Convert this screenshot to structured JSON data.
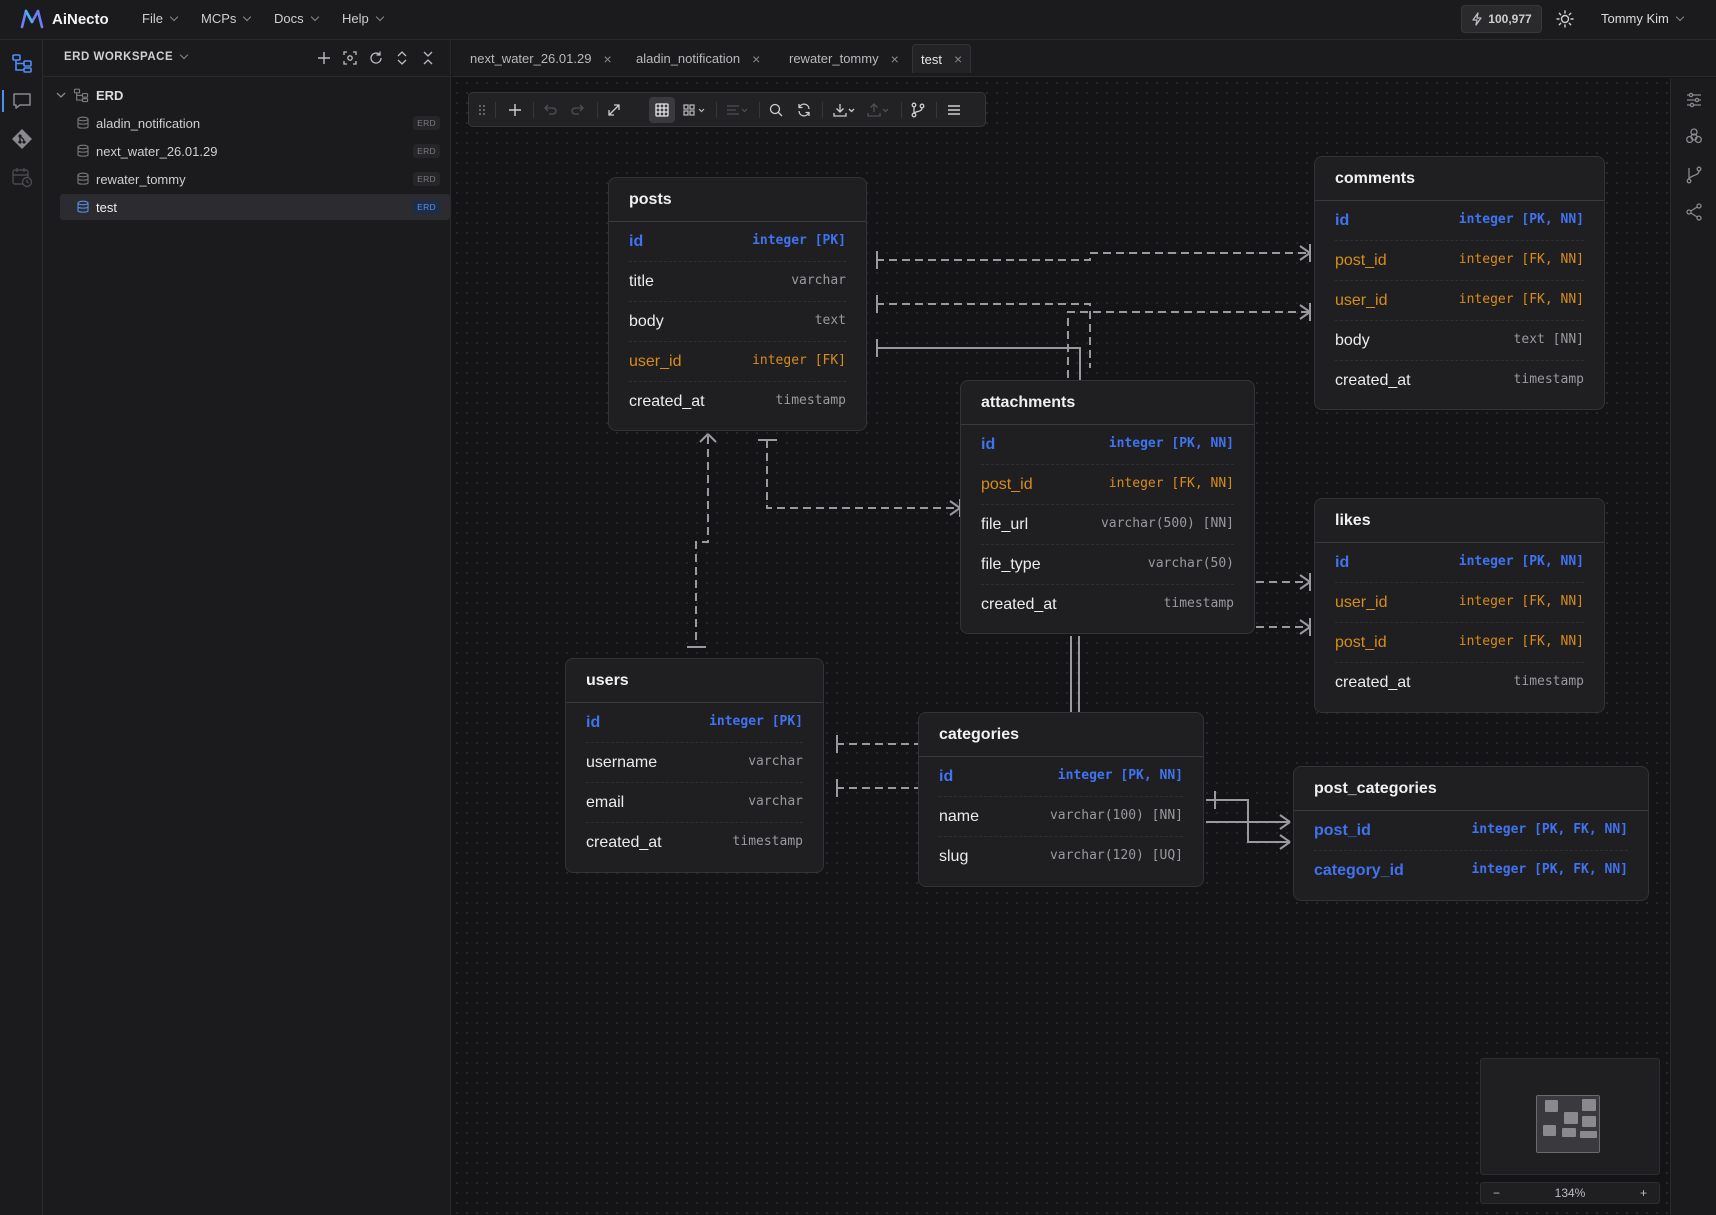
{
  "app": {
    "name": "AiNecto"
  },
  "menu": [
    "File",
    "MCPs",
    "Docs",
    "Help"
  ],
  "header": {
    "credits": "100,977",
    "user": "Tommy Kim"
  },
  "sidebar": {
    "title": "ERD WORKSPACE",
    "root": "ERD",
    "items": [
      {
        "label": "aladin_notification",
        "badge": "ERD"
      },
      {
        "label": "next_water_26.01.29",
        "badge": "ERD"
      },
      {
        "label": "rewater_tommy",
        "badge": "ERD"
      },
      {
        "label": "test",
        "badge": "ERD"
      }
    ]
  },
  "tabs": [
    {
      "label": "next_water_26.01.29"
    },
    {
      "label": "aladin_notification"
    },
    {
      "label": "rewater_tommy"
    },
    {
      "label": "test"
    }
  ],
  "tables": {
    "posts": {
      "name": "posts",
      "columns": [
        {
          "name": "id",
          "type": "integer [PK]"
        },
        {
          "name": "title",
          "type": "varchar"
        },
        {
          "name": "body",
          "type": "text"
        },
        {
          "name": "user_id",
          "type": "integer [FK]"
        },
        {
          "name": "created_at",
          "type": "timestamp"
        }
      ]
    },
    "comments": {
      "name": "comments",
      "columns": [
        {
          "name": "id",
          "type": "integer [PK, NN]"
        },
        {
          "name": "post_id",
          "type": "integer [FK, NN]"
        },
        {
          "name": "user_id",
          "type": "integer [FK, NN]"
        },
        {
          "name": "body",
          "type": "text [NN]"
        },
        {
          "name": "created_at",
          "type": "timestamp"
        }
      ]
    },
    "attachments": {
      "name": "attachments",
      "columns": [
        {
          "name": "id",
          "type": "integer [PK, NN]"
        },
        {
          "name": "post_id",
          "type": "integer [FK, NN]"
        },
        {
          "name": "file_url",
          "type": "varchar(500) [NN]"
        },
        {
          "name": "file_type",
          "type": "varchar(50)"
        },
        {
          "name": "created_at",
          "type": "timestamp"
        }
      ]
    },
    "likes": {
      "name": "likes",
      "columns": [
        {
          "name": "id",
          "type": "integer [PK, NN]"
        },
        {
          "name": "user_id",
          "type": "integer [FK, NN]"
        },
        {
          "name": "post_id",
          "type": "integer [FK, NN]"
        },
        {
          "name": "created_at",
          "type": "timestamp"
        }
      ]
    },
    "users": {
      "name": "users",
      "columns": [
        {
          "name": "id",
          "type": "integer [PK]"
        },
        {
          "name": "username",
          "type": "varchar"
        },
        {
          "name": "email",
          "type": "varchar"
        },
        {
          "name": "created_at",
          "type": "timestamp"
        }
      ]
    },
    "categories": {
      "name": "categories",
      "columns": [
        {
          "name": "id",
          "type": "integer [PK, NN]"
        },
        {
          "name": "name",
          "type": "varchar(100) [NN]"
        },
        {
          "name": "slug",
          "type": "varchar(120) [UQ]"
        }
      ]
    },
    "post_categories": {
      "name": "post_categories",
      "columns": [
        {
          "name": "post_id",
          "type": "integer [PK, FK, NN]"
        },
        {
          "name": "category_id",
          "type": "integer [PK, FK, NN]"
        }
      ]
    }
  },
  "zoom": {
    "minus": "−",
    "level": "134%",
    "plus": "+"
  },
  "colors": {
    "accent": "#4f8df7",
    "pk": "#3f73f0",
    "fk": "#d88c1a"
  }
}
